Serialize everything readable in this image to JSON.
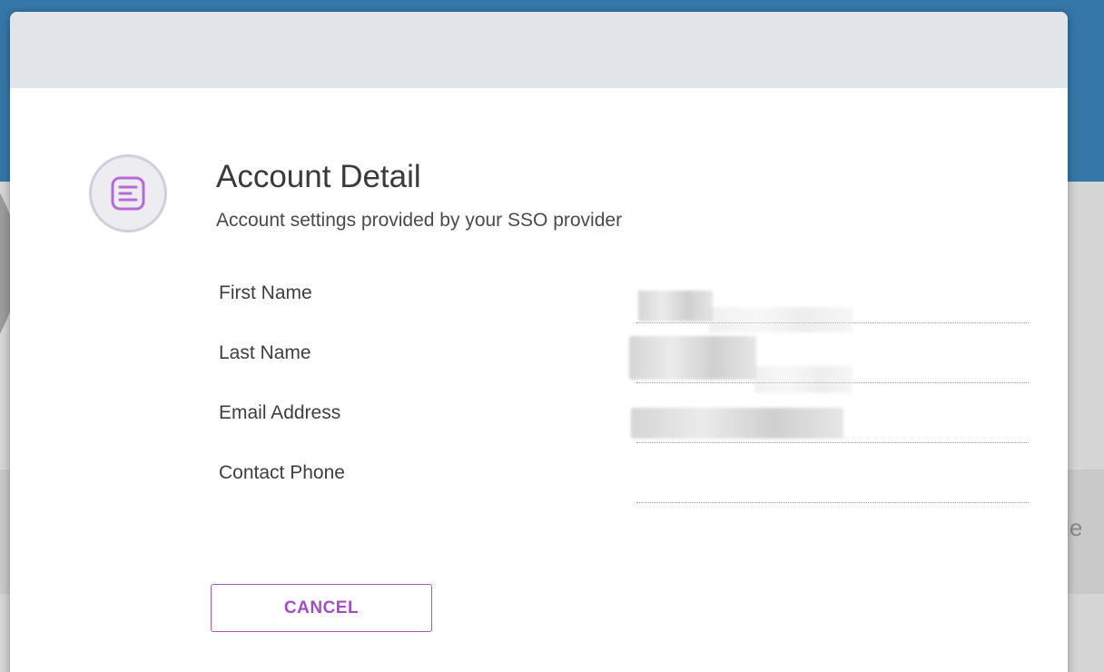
{
  "dialog": {
    "title": "Account Detail",
    "subtitle": "Account settings provided by your SSO provider",
    "icon": "document-lines-icon",
    "fields": [
      {
        "label": "First Name",
        "value": ""
      },
      {
        "label": "Last Name",
        "value": ""
      },
      {
        "label": "Email Address",
        "value": ""
      },
      {
        "label": "Contact Phone",
        "value": ""
      }
    ],
    "cancel_label": "CANCEL"
  },
  "background": {
    "partial_text": "mple"
  },
  "colors": {
    "accent": "#a855c7",
    "header_bar": "#3577a8",
    "dialog_header": "#e1e4e9"
  }
}
